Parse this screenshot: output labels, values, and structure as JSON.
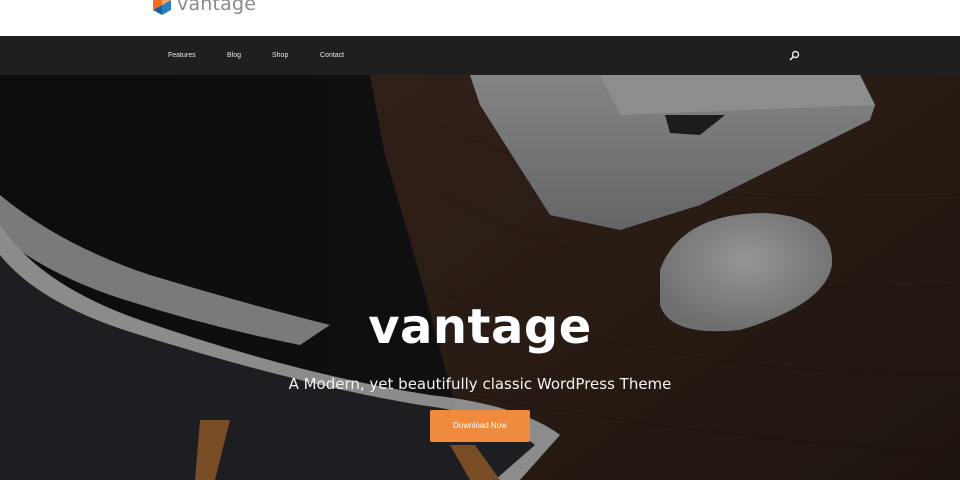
{
  "brand": {
    "logo_text": "vantage",
    "colors": {
      "logo_orange": "#f26b21",
      "logo_blue": "#2d7fc1",
      "accent": "#f08a3c",
      "nav_bg": "#1f1f1f"
    }
  },
  "nav": {
    "items": [
      {
        "label": "Features"
      },
      {
        "label": "Blog"
      },
      {
        "label": "Shop"
      },
      {
        "label": "Contact"
      }
    ],
    "search_icon": "search-icon"
  },
  "hero": {
    "title": "vantage",
    "tagline": "A Modern, yet beautifully classic WordPress Theme",
    "cta_label": "Download Now"
  }
}
